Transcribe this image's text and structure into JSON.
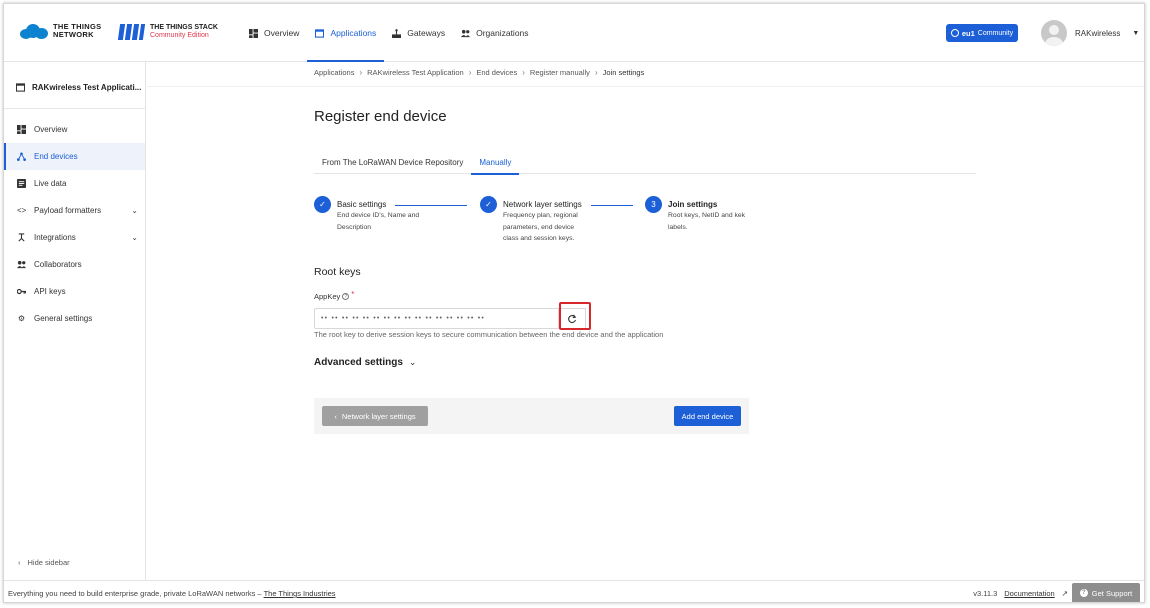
{
  "header": {
    "ttn_logo_line1": "THE THINGS",
    "ttn_logo_line2": "NETWORK",
    "tts_logo_line1": "THE THINGS STACK",
    "tts_logo_line2": "Community Edition",
    "nav": [
      {
        "label": "Overview",
        "icon": "grid-icon",
        "active": false
      },
      {
        "label": "Applications",
        "icon": "window-icon",
        "active": true
      },
      {
        "label": "Gateways",
        "icon": "gateway-icon",
        "active": false
      },
      {
        "label": "Organizations",
        "icon": "people-icon",
        "active": false
      }
    ],
    "cluster_region": "eu1",
    "cluster_label": "Community",
    "username": "RAKwireless"
  },
  "sidebar": {
    "app_title": "RAKwireless Test Applicati...",
    "items": [
      {
        "label": "Overview",
        "icon": "grid-icon"
      },
      {
        "label": "End devices",
        "icon": "devices-icon",
        "active": true
      },
      {
        "label": "Live data",
        "icon": "list-icon"
      },
      {
        "label": "Payload formatters",
        "icon": "code-icon",
        "expandable": true
      },
      {
        "label": "Integrations",
        "icon": "integrations-icon",
        "expandable": true
      },
      {
        "label": "Collaborators",
        "icon": "people-icon"
      },
      {
        "label": "API keys",
        "icon": "key-icon"
      },
      {
        "label": "General settings",
        "icon": "gear-icon"
      }
    ],
    "hide_label": "Hide sidebar"
  },
  "breadcrumb": [
    "Applications",
    "RAKwireless Test Application",
    "End devices",
    "Register manually",
    "Join settings"
  ],
  "page_title": "Register end device",
  "tabs": [
    {
      "label": "From The LoRaWAN Device Repository",
      "active": false
    },
    {
      "label": "Manually",
      "active": true
    }
  ],
  "steps": [
    {
      "title": "Basic settings",
      "desc_lines": [
        "End device ID's, Name and",
        "Description"
      ],
      "marker": "✓"
    },
    {
      "title": "Network layer settings",
      "desc_lines": [
        "Frequency plan, regional",
        "parameters, end device",
        "class and session keys."
      ],
      "marker": "✓"
    },
    {
      "title": "Join settings",
      "desc_lines": [
        "Root keys, NetID and kek",
        "labels."
      ],
      "marker": "3"
    }
  ],
  "root_keys": {
    "title": "Root keys",
    "appkey_label": "AppKey",
    "appkey_value": "•• •• •• •• •• •• •• •• •• •• •• •• •• •• •• ••",
    "help": "The root key to derive session keys to secure communication between the end device and the application"
  },
  "advanced_label": "Advanced settings",
  "buttons": {
    "back": "Network layer settings",
    "add": "Add end device"
  },
  "footer": {
    "text": "Everything you need to build enterprise grade, private LoRaWAN networks – ",
    "link": "The Things Industries",
    "version": "v3.11.3",
    "docs": "Documentation",
    "support": "Get Support"
  },
  "colors": {
    "primary": "#1c5fd7",
    "highlight": "#d9262b"
  }
}
